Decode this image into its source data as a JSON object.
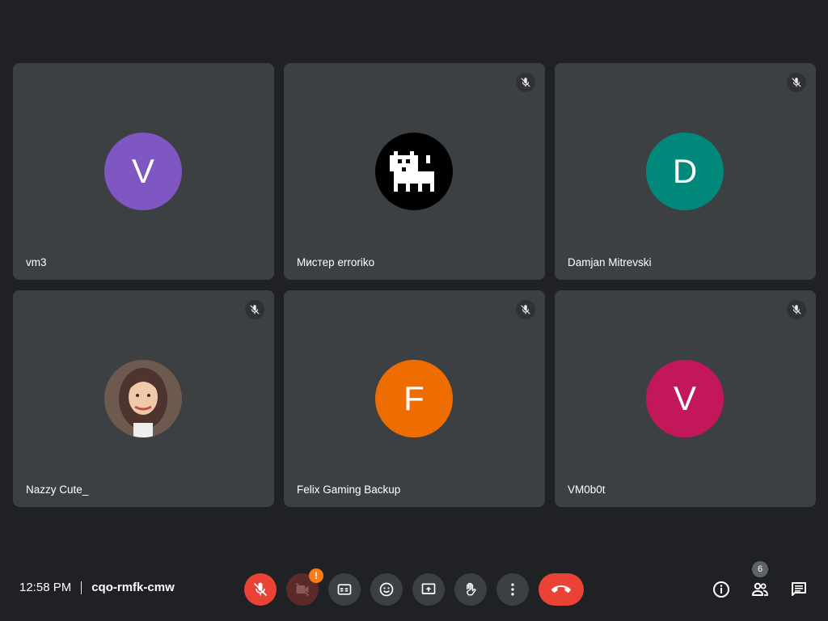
{
  "participants": [
    {
      "name": "vm3",
      "initial": "V",
      "avatar_color": "#7e57c2",
      "muted": false
    },
    {
      "name": "Мистер erroriko",
      "initial": "",
      "avatar_color": "#000000",
      "muted": true,
      "avatar_type": "pixel-dog-icon"
    },
    {
      "name": "Damjan Mitrevski",
      "initial": "D",
      "avatar_color": "#00897b",
      "muted": true
    },
    {
      "name": "Nazzy Cute_",
      "initial": "",
      "avatar_color": "#8d6e63",
      "muted": true,
      "avatar_type": "photo-portrait"
    },
    {
      "name": "Felix Gaming Backup",
      "initial": "F",
      "avatar_color": "#ef6c00",
      "muted": true
    },
    {
      "name": "VM0b0t",
      "initial": "V",
      "avatar_color": "#c2185b",
      "muted": true
    }
  ],
  "meeting": {
    "time": "12:58 PM",
    "code": "cqo-rmfk-cmw"
  },
  "controls": {
    "camera_warning": "!",
    "people_count": "6"
  },
  "colors": {
    "background": "#202124",
    "tile": "#3c4043",
    "danger": "#ea4335",
    "warning": "#fa7b17"
  }
}
